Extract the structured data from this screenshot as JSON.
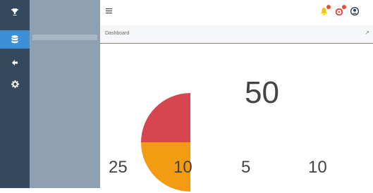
{
  "sidebar": {
    "icons": [
      "trophy-icon",
      "database-icon",
      "back-arrow-icon",
      "gear-icon"
    ],
    "menu": {
      "header": "",
      "items": [
        {
          "label": ""
        },
        {
          "label": ""
        },
        {
          "label": ""
        }
      ]
    }
  },
  "header": {
    "user_name": ""
  },
  "breadcrumb": {
    "title": "Dashboard"
  },
  "stats": {
    "title": "",
    "subtitle": "",
    "main_value": "50",
    "main_label": "",
    "items": [
      {
        "value": "25",
        "label": ""
      },
      {
        "value": "10",
        "label": ""
      },
      {
        "value": "5",
        "label": ""
      },
      {
        "value": "10",
        "label": ""
      }
    ]
  },
  "chart_data": {
    "type": "pie",
    "title": "",
    "slices": [
      {
        "value": 10,
        "color": "#d64550"
      },
      {
        "value": 10,
        "color": "#f39c12"
      }
    ]
  },
  "colors": {
    "accent": "#3d8fd6",
    "iconbar": "#34495e",
    "menu": "#8ea0b1"
  }
}
